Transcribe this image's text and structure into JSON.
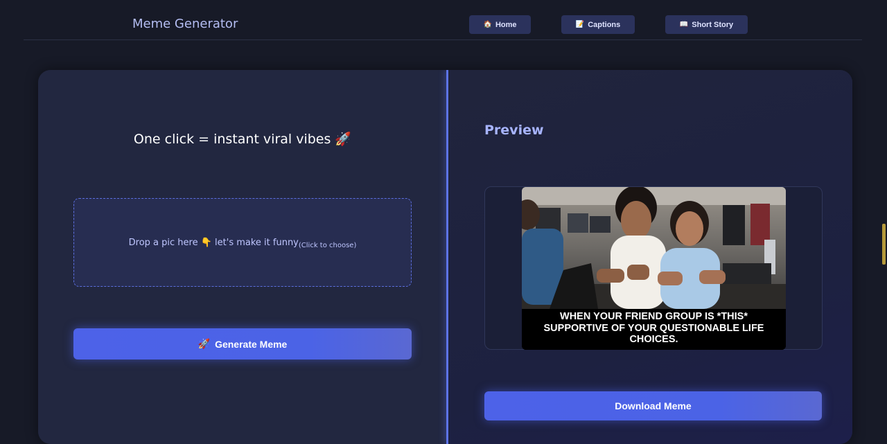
{
  "header": {
    "brand": "Meme Generator",
    "nav": [
      {
        "icon": "🏠",
        "icon_name": "home-icon",
        "label": "Home"
      },
      {
        "icon": "📝",
        "icon_name": "memo-icon",
        "label": "Captions"
      },
      {
        "icon": "📖",
        "icon_name": "book-icon",
        "label": "Short Story"
      }
    ]
  },
  "left": {
    "tagline": "One click = instant viral vibes 🚀",
    "dropzone": {
      "text": "Drop a pic here 👇 let's make it funny",
      "hint": "(Click to choose)"
    },
    "generate": {
      "icon": "🚀",
      "icon_name": "rocket-icon",
      "label": "Generate Meme"
    }
  },
  "right": {
    "title": "Preview",
    "meme_caption": "WHEN YOUR FRIEND GROUP IS *THIS* SUPPORTIVE OF YOUR QUESTIONABLE LIFE CHOICES.",
    "download_label": "Download Meme"
  },
  "colors": {
    "background": "#171a27",
    "accent": "#4d62e8",
    "brand_text": "#b4bdf2",
    "preview_title": "#a7b4ff"
  }
}
